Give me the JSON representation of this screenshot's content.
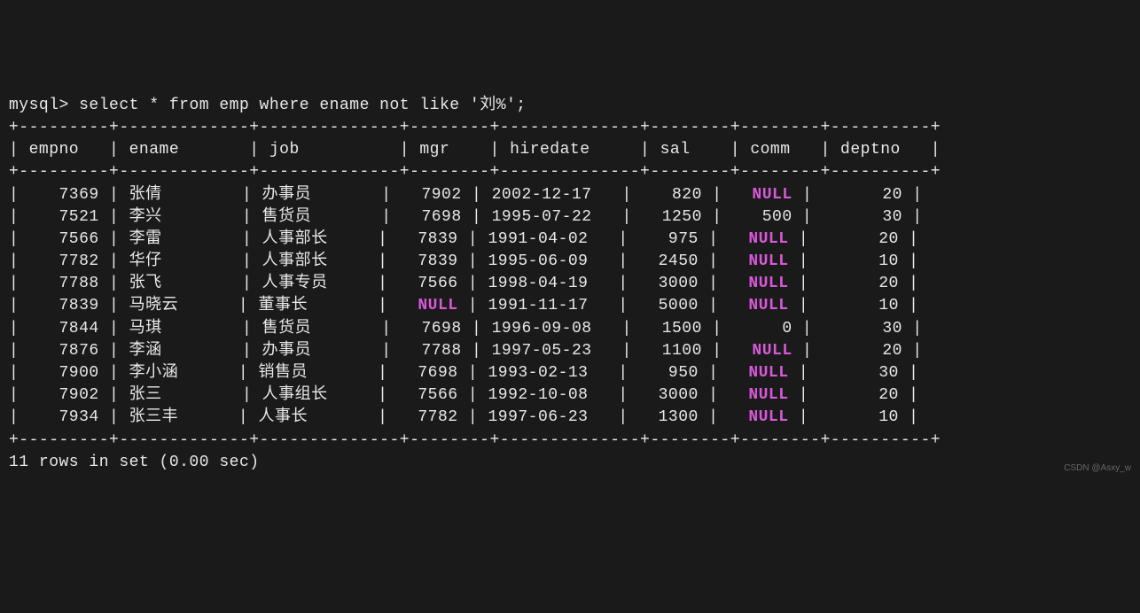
{
  "prompt": "mysql> ",
  "query": "select * from emp where ename not like '刘%';",
  "columns": [
    "empno",
    "ename",
    "job",
    "mgr",
    "hiredate",
    "sal",
    "comm",
    "deptno"
  ],
  "widths": [
    7,
    11,
    12,
    6,
    12,
    6,
    6,
    8
  ],
  "align": [
    "right",
    "left",
    "left",
    "right",
    "left",
    "right",
    "right",
    "right"
  ],
  "rows": [
    {
      "empno": "7369",
      "ename": "张倩",
      "job": "办事员",
      "mgr": "7902",
      "hiredate": "2002-12-17",
      "sal": "820",
      "comm": "NULL",
      "deptno": "20"
    },
    {
      "empno": "7521",
      "ename": "李兴",
      "job": "售货员",
      "mgr": "7698",
      "hiredate": "1995-07-22",
      "sal": "1250",
      "comm": "500",
      "deptno": "30"
    },
    {
      "empno": "7566",
      "ename": "李雷",
      "job": "人事部长",
      "mgr": "7839",
      "hiredate": "1991-04-02",
      "sal": "975",
      "comm": "NULL",
      "deptno": "20"
    },
    {
      "empno": "7782",
      "ename": "华仔",
      "job": "人事部长",
      "mgr": "7839",
      "hiredate": "1995-06-09",
      "sal": "2450",
      "comm": "NULL",
      "deptno": "10"
    },
    {
      "empno": "7788",
      "ename": "张飞",
      "job": "人事专员",
      "mgr": "7566",
      "hiredate": "1998-04-19",
      "sal": "3000",
      "comm": "NULL",
      "deptno": "20"
    },
    {
      "empno": "7839",
      "ename": "马晓云",
      "job": "董事长",
      "mgr": "NULL",
      "hiredate": "1991-11-17",
      "sal": "5000",
      "comm": "NULL",
      "deptno": "10"
    },
    {
      "empno": "7844",
      "ename": "马琪",
      "job": "售货员",
      "mgr": "7698",
      "hiredate": "1996-09-08",
      "sal": "1500",
      "comm": "0",
      "deptno": "30"
    },
    {
      "empno": "7876",
      "ename": "李涵",
      "job": "办事员",
      "mgr": "7788",
      "hiredate": "1997-05-23",
      "sal": "1100",
      "comm": "NULL",
      "deptno": "20"
    },
    {
      "empno": "7900",
      "ename": "李小涵",
      "job": "销售员",
      "mgr": "7698",
      "hiredate": "1993-02-13",
      "sal": "950",
      "comm": "NULL",
      "deptno": "30"
    },
    {
      "empno": "7902",
      "ename": "张三",
      "job": "人事组长",
      "mgr": "7566",
      "hiredate": "1992-10-08",
      "sal": "3000",
      "comm": "NULL",
      "deptno": "20"
    },
    {
      "empno": "7934",
      "ename": "张三丰",
      "job": "人事长",
      "mgr": "7782",
      "hiredate": "1997-06-23",
      "sal": "1300",
      "comm": "NULL",
      "deptno": "10"
    }
  ],
  "footer": "11 rows in set (0.00 sec)",
  "watermark": "CSDN @Asxy_w"
}
